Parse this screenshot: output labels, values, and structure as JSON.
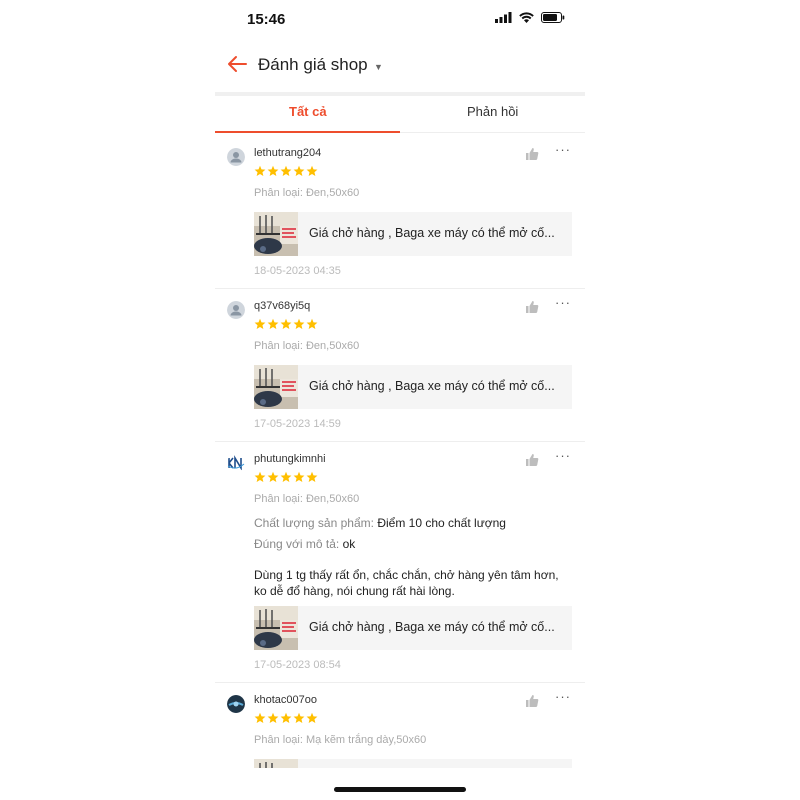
{
  "status_bar": {
    "time": "15:46"
  },
  "header": {
    "title": "Đánh giá shop"
  },
  "tabs": [
    {
      "label": "Tất cả"
    },
    {
      "label": "Phản hồi"
    }
  ],
  "reviews": [
    {
      "username": "lethutrang204",
      "rating": 5,
      "variant": "Phân loại: Đen,50x60",
      "product_title": "Giá chở hàng , Baga xe máy có thể mở cố...",
      "timestamp": "18-05-2023 04:35"
    },
    {
      "username": "q37v68yi5q",
      "rating": 5,
      "variant": "Phân loại: Đen,50x60",
      "product_title": "Giá chở hàng , Baga xe máy có thể mở cố...",
      "timestamp": "17-05-2023 14:59"
    },
    {
      "username": "phutungkimnhi",
      "rating": 5,
      "variant": "Phân loại: Đen,50x60",
      "quality_label": "Chất lượng sản phẩm:",
      "quality_value": "Điểm 10 cho chất lượng",
      "match_label": "Đúng với mô tả:",
      "match_value": "ok",
      "comment": "Dùng 1 tg thấy rất ổn, chắc chắn, chở hàng yên tâm hơn, ko dễ đổ hàng, nói chung rất hài lòng.",
      "product_title": "Giá chở hàng , Baga xe máy có thể mở cố...",
      "timestamp": "17-05-2023 08:54"
    },
    {
      "username": "khotac007oo",
      "rating": 5,
      "variant": "Phân loại: Mạ kẽm trắng dày,50x60"
    }
  ],
  "colors": {
    "accent": "#ee4d2d",
    "star": "#ffbf00"
  },
  "icons": [
    "back-arrow-icon",
    "caret-down-icon",
    "like-icon",
    "more-icon",
    "star-icon",
    "avatar-icon",
    "signal-icon",
    "wifi-icon",
    "battery-icon"
  ]
}
